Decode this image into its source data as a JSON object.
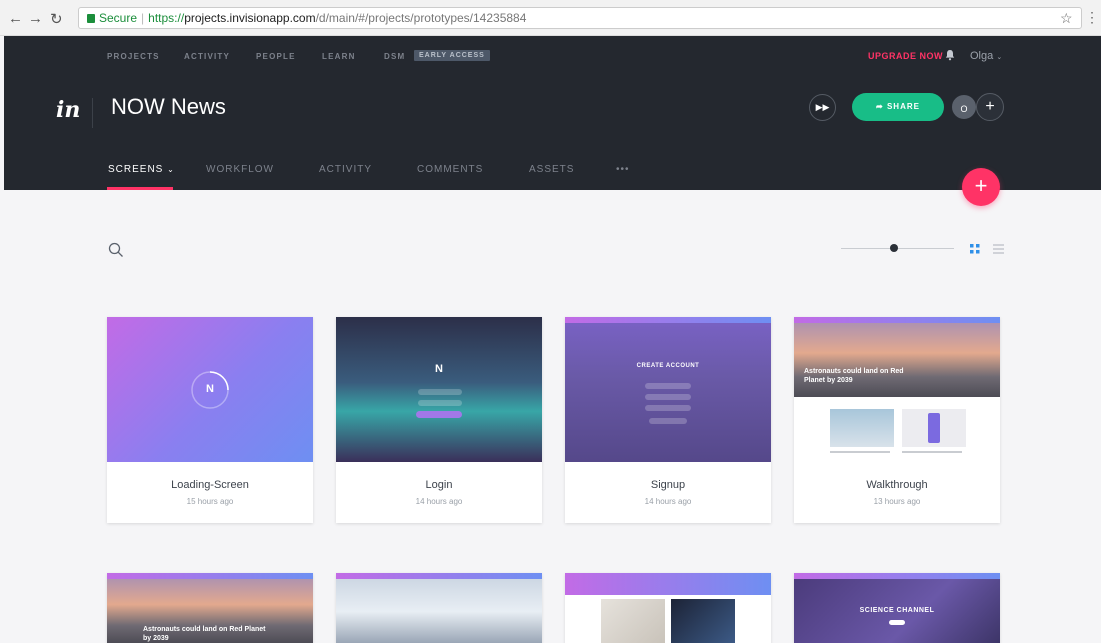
{
  "browser": {
    "secure_label": "Secure",
    "url_scheme": "https://",
    "url_host": "projects.invisionapp.com",
    "url_path": "/d/main/#/projects/prototypes/14235884"
  },
  "topnav": {
    "items": [
      "PROJECTS",
      "ACTIVITY",
      "PEOPLE",
      "LEARN",
      "DSM"
    ],
    "badge": "EARLY ACCESS",
    "upgrade": "UPGRADE NOW",
    "user": "Olga"
  },
  "project": {
    "logo": "in",
    "title": "NOW News",
    "share_label": "SHARE",
    "avatar_initial": "O"
  },
  "tabs": [
    "SCREENS",
    "WORKFLOW",
    "ACTIVITY",
    "COMMENTS",
    "ASSETS",
    "•••"
  ],
  "active_tab": "SCREENS",
  "colors": {
    "accent": "#ff3366",
    "share": "#18bd87",
    "header_bg": "#24282f"
  },
  "screens": [
    {
      "name": "Loading-Screen",
      "time": "15 hours ago",
      "thumb_text": "N"
    },
    {
      "name": "Login",
      "time": "14 hours ago",
      "thumb_text": "N"
    },
    {
      "name": "Signup",
      "time": "14 hours ago",
      "thumb_text": "CREATE ACCOUNT"
    },
    {
      "name": "Walkthrough",
      "time": "13 hours ago",
      "thumb_text": "Astronauts could land on Red Planet by 2039"
    }
  ],
  "row2_thumbs": {
    "first_headline": "Astronauts could land on Red Planet by 2039",
    "fourth_headline": "SCIENCE CHANNEL"
  }
}
